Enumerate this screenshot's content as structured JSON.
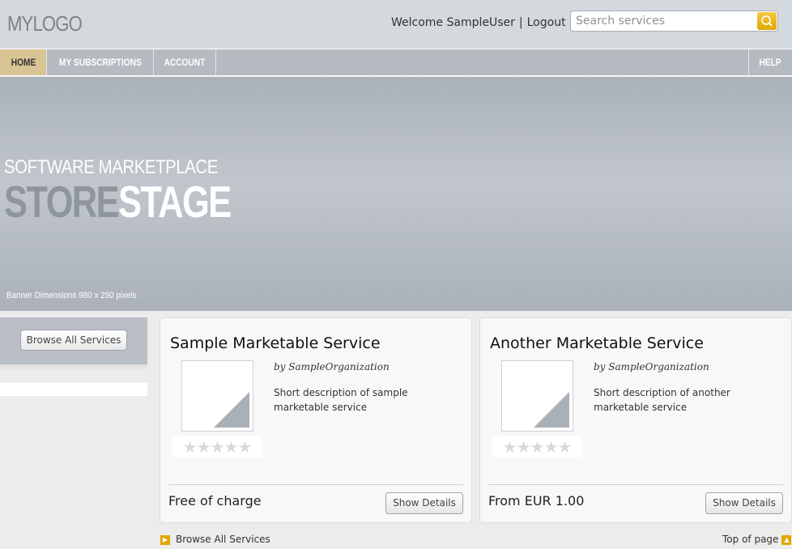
{
  "header": {
    "logo": "MYLOGO",
    "welcome": "Welcome SampleUser",
    "separator": "|",
    "logout": "Logout",
    "search_placeholder": "Search services"
  },
  "nav": {
    "home": "HOME",
    "subscriptions": "MY SUBSCRIPTIONS",
    "account": "ACCOUNT",
    "help": "HELP"
  },
  "banner": {
    "subtitle": "SOFTWARE MARKETPLACE",
    "title_part1": "STORE",
    "title_part2": "STAGE",
    "dimensions": "Banner Dimensions 980 x 290 pixels"
  },
  "sidebar": {
    "browse_all": "Browse All Services"
  },
  "services": [
    {
      "title": "Sample Marketable Service",
      "organization": "by SampleOrganization",
      "description": "Short description of sample marketable service",
      "rating": "★★★★★",
      "price": "Free of charge",
      "details": "Show Details"
    },
    {
      "title": "Another Marketable Service",
      "organization": "by SampleOrganization",
      "description": "Short description of another marketable service",
      "rating": "★★★★★",
      "price": "From EUR 1.00",
      "details": "Show Details"
    }
  ],
  "footer": {
    "browse_all": "Browse All Services",
    "top_of_page": "Top of page"
  },
  "colors": {
    "accent": "#e0a800",
    "nav_active": "#d9c594",
    "nav_bg": "#b5bbc1",
    "header_bg": "#d4d9de"
  },
  "icons": {
    "search_button": "search-icon",
    "footer_browse": "chevron-right-icon",
    "footer_top": "chevron-up-icon"
  }
}
